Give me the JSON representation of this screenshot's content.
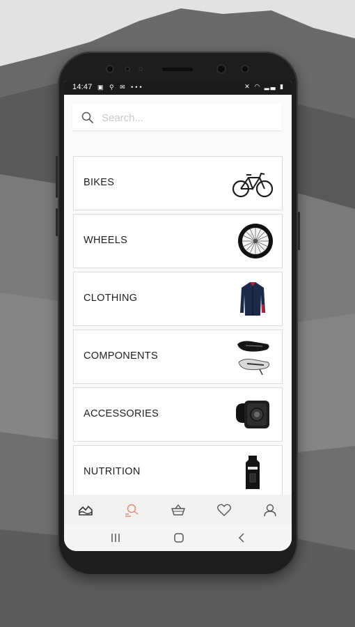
{
  "status_bar": {
    "time": "14:47",
    "left_icons": [
      "image-icon",
      "location-icon",
      "mail-icon",
      "more-dots-icon"
    ],
    "left_glyphs": "▣ ⚲ ✉ •••",
    "right_icons": [
      "mute-icon",
      "wifi-icon",
      "signal-icon",
      "battery-icon"
    ],
    "right_glyphs": "✕ ◠ ▂▃ ▮"
  },
  "search": {
    "placeholder": "Search..."
  },
  "categories": [
    {
      "label": "BIKES",
      "icon": "bike-icon"
    },
    {
      "label": "WHEELS",
      "icon": "wheel-icon"
    },
    {
      "label": "CLOTHING",
      "icon": "jacket-icon"
    },
    {
      "label": "COMPONENTS",
      "icon": "saddle-icon"
    },
    {
      "label": "ACCESSORIES",
      "icon": "bike-light-icon"
    },
    {
      "label": "NUTRITION",
      "icon": "energy-gel-icon"
    }
  ],
  "tab_bar": {
    "items": [
      "discover-icon",
      "search-user-icon",
      "basket-icon",
      "heart-icon",
      "profile-icon"
    ],
    "active_index": 1,
    "active_color": "#e08a78",
    "inactive_color": "#555555"
  },
  "android_nav": [
    "recents-icon",
    "home-icon",
    "back-icon"
  ]
}
